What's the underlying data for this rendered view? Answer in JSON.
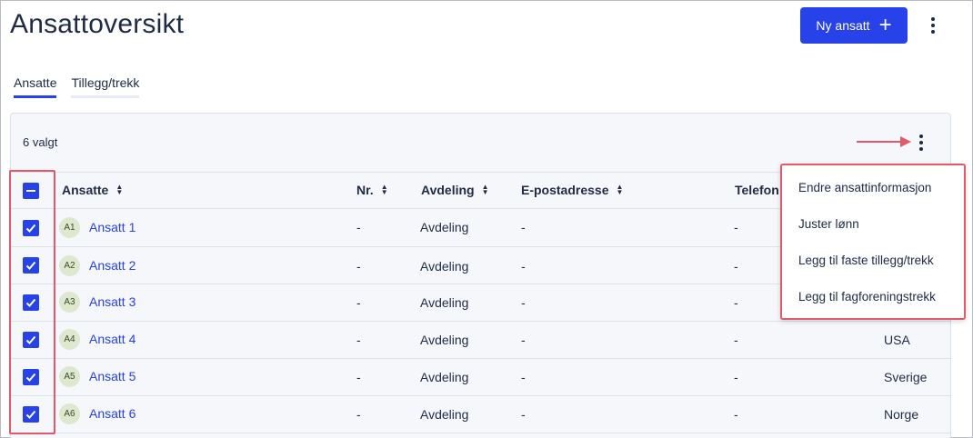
{
  "page": {
    "title": "Ansattoversikt"
  },
  "header": {
    "new_employee_label": "Ny ansatt"
  },
  "tabs": [
    {
      "label": "Ansatte",
      "active": true
    },
    {
      "label": "Tillegg/trekk",
      "active": false
    }
  ],
  "selection": {
    "count_label": "6 valgt"
  },
  "table": {
    "columns": [
      "Ansatte",
      "Nr.",
      "Avdeling",
      "E-postadresse",
      "Telefon"
    ],
    "rows": [
      {
        "initials": "A1",
        "name": "Ansatt 1",
        "nr": "-",
        "department": "Avdeling",
        "email": "-",
        "phone": "-",
        "country": "",
        "checked": true
      },
      {
        "initials": "A2",
        "name": "Ansatt 2",
        "nr": "-",
        "department": "Avdeling",
        "email": "-",
        "phone": "-",
        "country": "",
        "checked": true
      },
      {
        "initials": "A3",
        "name": "Ansatt 3",
        "nr": "-",
        "department": "Avdeling",
        "email": "-",
        "phone": "-",
        "country": "",
        "checked": true
      },
      {
        "initials": "A4",
        "name": "Ansatt 4",
        "nr": "-",
        "department": "Avdeling",
        "email": "-",
        "phone": "-",
        "country": "USA",
        "checked": true
      },
      {
        "initials": "A5",
        "name": "Ansatt 5",
        "nr": "-",
        "department": "Avdeling",
        "email": "-",
        "phone": "-",
        "country": "Sverige",
        "checked": true
      },
      {
        "initials": "A6",
        "name": "Ansatt 6",
        "nr": "-",
        "department": "Avdeling",
        "email": "-",
        "phone": "-",
        "country": "Norge",
        "checked": true
      }
    ]
  },
  "context_menu": {
    "items": [
      "Endre ansattinformasjon",
      "Juster lønn",
      "Legg til faste tillegg/trekk",
      "Legg til fagforeningstrekk"
    ]
  },
  "colors": {
    "accent": "#2642e8",
    "highlight": "#e05a6a",
    "text": "#1f2a44"
  },
  "icons": [
    "plus-icon",
    "kebab-menu-icon",
    "sort-icon",
    "checkbox-checked-icon",
    "checkbox-indeterminate-icon",
    "arrow-right-icon"
  ]
}
